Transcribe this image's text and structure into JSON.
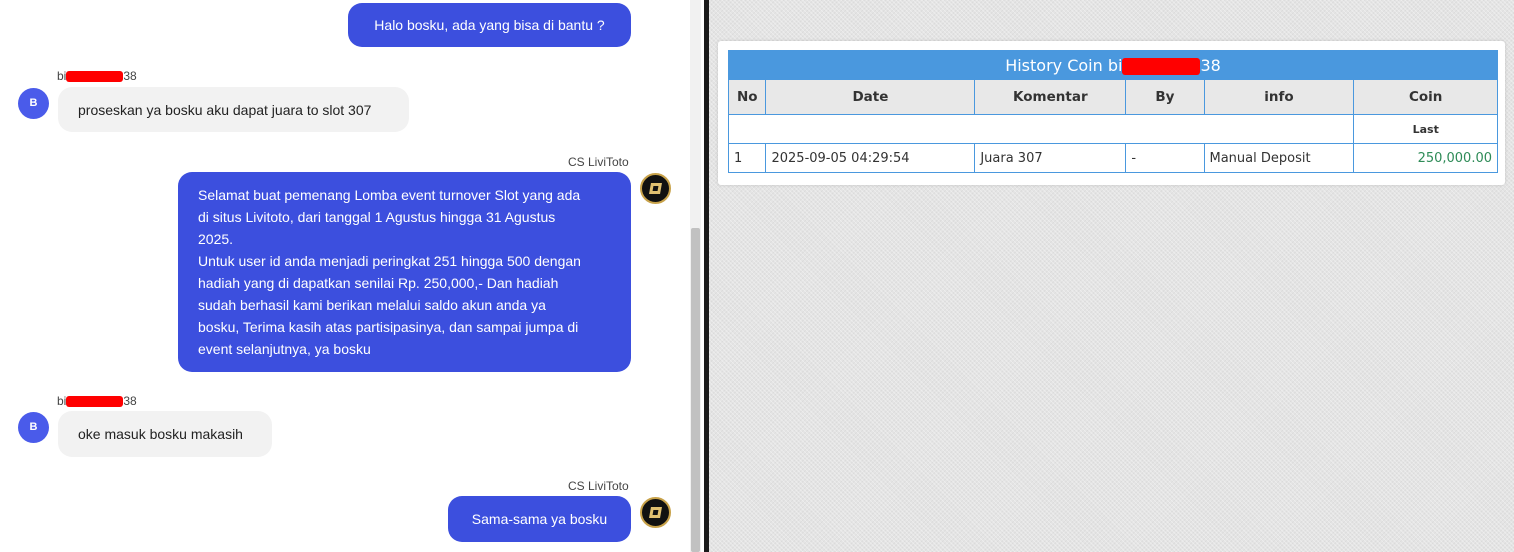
{
  "chat": {
    "messages": [
      {
        "type": "out",
        "text": "Halo bosku, ada yang bisa di bantu ?"
      },
      {
        "type": "in",
        "sender_prefix": "bi",
        "sender_suffix": "38",
        "avatar_letter": "B",
        "text": "proseskan ya bosku aku dapat juara to slot 307"
      },
      {
        "type": "out",
        "sender": "CS LiviToto",
        "lines": [
          "Selamat buat pemenang Lomba event turnover Slot yang ada",
          "di situs Livitoto, dari tanggal 1 Agustus hingga 31 Agustus",
          "2025.",
          "Untuk user id anda menjadi peringkat 251 hingga 500 dengan",
          "hadiah yang di dapatkan senilai Rp. 250,000,- Dan hadiah",
          "sudah berhasil kami berikan melalui saldo akun anda ya",
          "bosku, Terima kasih atas partisipasinya, dan sampai jumpa di",
          "event selanjutnya, ya bosku"
        ]
      },
      {
        "type": "in",
        "sender_prefix": "bi",
        "sender_suffix": "38",
        "avatar_letter": "B",
        "text": "oke masuk bosku makasih"
      },
      {
        "type": "out",
        "sender": "CS LiviToto",
        "text": "Sama-sama ya bosku"
      }
    ],
    "colors": {
      "outgoing_bubble": "#3c4fde",
      "incoming_bubble": "#f2f2f2",
      "redaction": "#ff0000"
    }
  },
  "history": {
    "title_prefix": "History Coin bi",
    "title_suffix": "38",
    "columns": [
      "No",
      "Date",
      "Komentar",
      "By",
      "info",
      "Coin"
    ],
    "last_label": "Last",
    "rows": [
      {
        "no": "1",
        "date": "2025-09-05 04:29:54",
        "komentar": "Juara 307",
        "by": "-",
        "info": "Manual Deposit",
        "coin": "250,000.00"
      }
    ],
    "colors": {
      "header": "#4a98de",
      "coin_positive": "#2e8b57"
    }
  }
}
